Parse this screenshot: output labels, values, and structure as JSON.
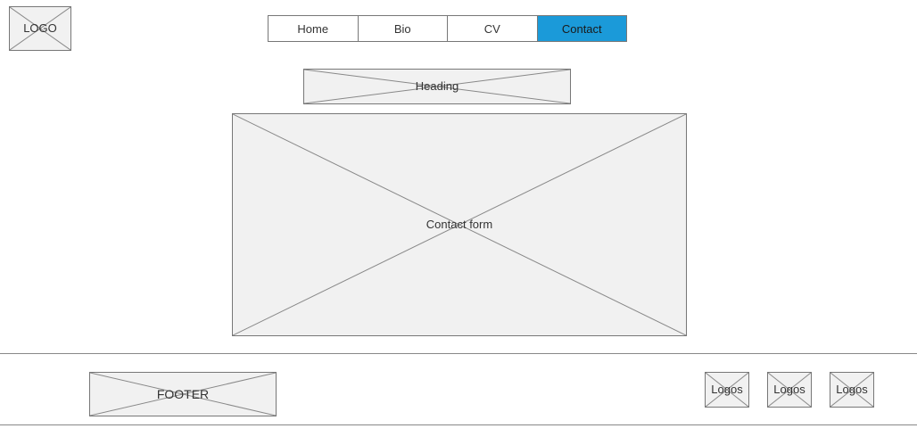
{
  "logo": {
    "label": "LOGO"
  },
  "nav": {
    "items": [
      {
        "label": "Home",
        "active": false
      },
      {
        "label": "Bio",
        "active": false
      },
      {
        "label": "CV",
        "active": false
      },
      {
        "label": "Contact",
        "active": true
      }
    ],
    "active_color": "#1b9ad9"
  },
  "main": {
    "heading": "Heading",
    "contact_form": "Contact form"
  },
  "footer": {
    "label": "FOOTER",
    "logos": [
      "Logos",
      "Logos",
      "Logos"
    ]
  },
  "colors": {
    "placeholder_fill": "#f1f1f1",
    "placeholder_border": "#777777",
    "divider": "#888888"
  }
}
